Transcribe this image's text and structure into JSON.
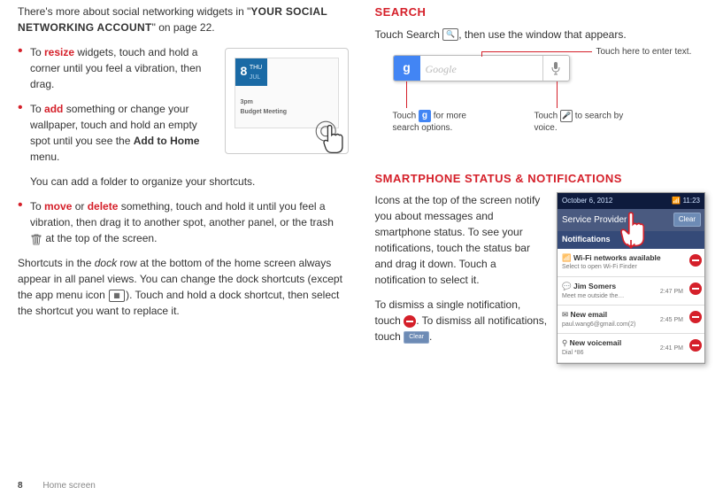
{
  "left": {
    "intro_a": "There's more about social networking widgets in \"",
    "intro_b": "YOUR SOCIAL NETWORKING ACCOUNT",
    "intro_c": "\" on page 22.",
    "b1_pre": "To ",
    "b1_kw": "resize",
    "b1_post": " widgets, touch and hold a corner until you feel a vibration, then drag.",
    "b2_pre": "To ",
    "b2_kw": "add",
    "b2_mid": " something or change your wallpaper, touch and hold an empty spot until you see the ",
    "b2_bold": "Add to Home",
    "b2_post": " menu.",
    "b2_extra": "You can add a folder to organize your shortcuts.",
    "b3_pre": "To ",
    "b3_kw1": "move",
    "b3_or": " or ",
    "b3_kw2": "delete",
    "b3_mid": " something, touch and hold it until you feel a vibration, then drag it to another spot, another panel, or the trash ",
    "b3_post": " at the top of the screen.",
    "para_a": "Shortcuts in the ",
    "para_dock": "dock",
    "para_b": " row at the bottom of the home screen always appear in all panel views. You can change the dock shortcuts (except the app menu icon ",
    "para_c": "). Touch and hold a dock shortcut, then select the shortcut you want to replace it.",
    "widget_num": "8",
    "widget_day": "THU",
    "widget_mon": "JUL",
    "widget_evt1": "3pm",
    "widget_evt2": "Budget Meeting"
  },
  "right": {
    "search_h": "Search",
    "search_p_a": "Touch Search ",
    "search_p_b": ", then use the window that appears.",
    "search_placeholder": "Google",
    "c1_a": "Touch ",
    "c1_b": " for more search options.",
    "c2": "Touch here to enter text.",
    "c3_a": "Touch ",
    "c3_b": " to search by voice.",
    "status_h": "Smartphone status & notifications",
    "status_p1": "Icons at the top of the screen notify you about messages and smartphone status. To see your notifications, touch the status bar and drag it down. Touch a notification to select it.",
    "status_p2_a": "To dismiss a single notification, touch ",
    "status_p2_b": ". To dismiss all notifications, touch ",
    "status_p2_c": ".",
    "notif": {
      "date": "October 6, 2012",
      "time": "11:23",
      "provider": "Service Provider",
      "clear": "Clear",
      "section": "Notifications",
      "items": [
        {
          "title": "Wi-Fi networks available",
          "sub": "Select to open Wi-Fi Finder",
          "time": ""
        },
        {
          "title": "Jim Somers",
          "sub": "Meet me outside the…",
          "time": "2:47 PM"
        },
        {
          "title": "New email",
          "sub": "paul.wang6@gmail.com(2)",
          "time": "2:45 PM"
        },
        {
          "title": "New voicemail",
          "sub": "Dial *86",
          "time": "2:41 PM"
        }
      ]
    }
  },
  "footer": {
    "num": "8",
    "label": "Home screen"
  }
}
